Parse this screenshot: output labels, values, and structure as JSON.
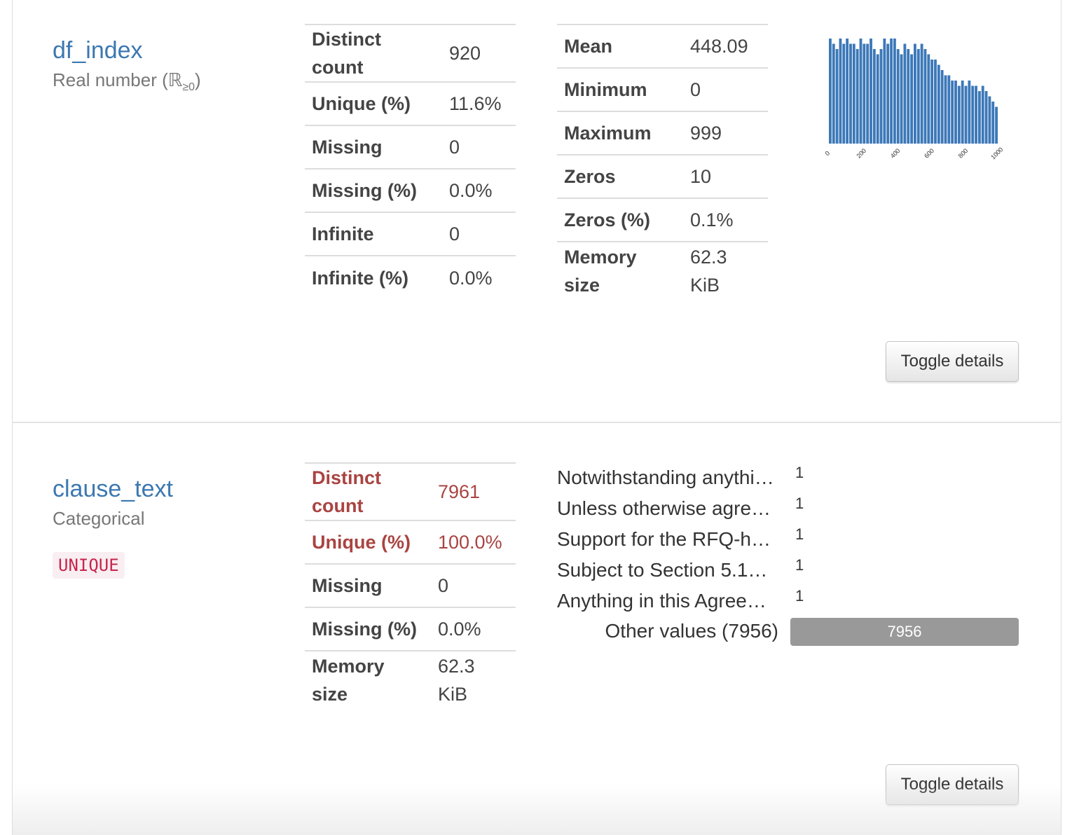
{
  "variables": [
    {
      "name": "df_index",
      "type_prefix": "Real number (",
      "type_symbol": "ℝ",
      "type_sub": "≥0",
      "type_suffix": ")",
      "stats_left": [
        {
          "label": "Distinct count",
          "value": "920"
        },
        {
          "label": "Unique (%)",
          "value": "11.6%"
        },
        {
          "label": "Missing",
          "value": "0"
        },
        {
          "label": "Missing (%)",
          "value": "0.0%"
        },
        {
          "label": "Infinite",
          "value": "0"
        },
        {
          "label": "Infinite (%)",
          "value": "0.0%"
        }
      ],
      "stats_right": [
        {
          "label": "Mean",
          "value": "448.09"
        },
        {
          "label": "Minimum",
          "value": "0"
        },
        {
          "label": "Maximum",
          "value": "999"
        },
        {
          "label": "Zeros",
          "value": "10"
        },
        {
          "label": "Zeros (%)",
          "value": "0.1%"
        },
        {
          "label": "Memory size",
          "value": "62.3 KiB"
        }
      ],
      "toggle_label": "Toggle details"
    },
    {
      "name": "clause_text",
      "type": "Categorical",
      "badge": "UNIQUE",
      "stats": [
        {
          "label": "Distinct count",
          "value": "7961",
          "alert": true
        },
        {
          "label": "Unique (%)",
          "value": "100.0%",
          "alert": true
        },
        {
          "label": "Missing",
          "value": "0",
          "alert": false
        },
        {
          "label": "Missing (%)",
          "value": "0.0%",
          "alert": false
        },
        {
          "label": "Memory size",
          "value": "62.3 KiB",
          "alert": false
        }
      ],
      "top_values": [
        {
          "label": "Notwithstanding anythi…",
          "count": "1"
        },
        {
          "label": "Unless otherwise agre…",
          "count": "1"
        },
        {
          "label": "Support for the RFQ-h…",
          "count": "1"
        },
        {
          "label": "Subject to Section 5.1…",
          "count": "1"
        },
        {
          "label": "Anything in this Agree…",
          "count": "1"
        }
      ],
      "other_values_label": "Other values (7956)",
      "other_values_count": "7956",
      "toggle_label": "Toggle details"
    }
  ],
  "chart_data": {
    "type": "bar",
    "bar_color": "#3c78b8",
    "xlim": [
      0,
      1000
    ],
    "xticks": [
      "0",
      "200",
      "400",
      "600",
      "800",
      "1000"
    ],
    "bin_width": 20,
    "values": [
      20,
      19,
      18,
      20,
      19,
      20,
      19,
      19,
      18,
      20,
      19,
      19,
      20,
      18,
      17,
      18,
      20,
      19,
      20,
      20,
      18,
      17,
      19,
      18,
      17,
      19,
      18,
      19,
      18,
      17,
      16,
      16,
      15,
      14,
      13,
      13,
      12,
      12,
      11,
      12,
      11,
      12,
      11,
      11,
      10,
      11,
      10,
      9,
      8,
      7
    ]
  }
}
